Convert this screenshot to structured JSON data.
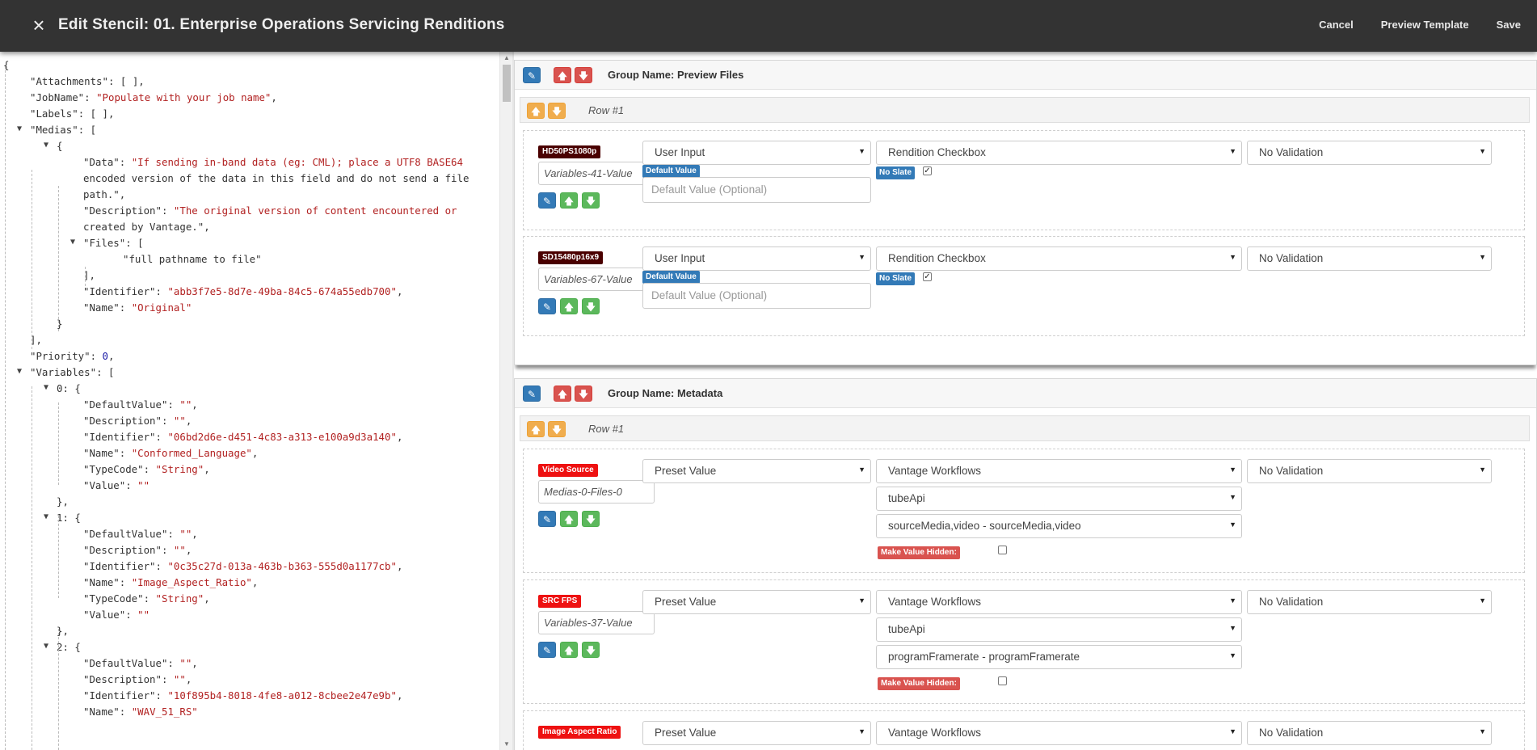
{
  "header": {
    "title": "Edit Stencil: 01. Enterprise Operations Servicing Renditions",
    "close_icon": "×",
    "actions": [
      "Cancel",
      "Preview Template",
      "Save"
    ]
  },
  "json_lines": [
    {
      "text": "{",
      "indent": 0
    },
    {
      "text": "\"Attachments\": [ ],",
      "indent": 1
    },
    {
      "text": "\"JobName\": \"Populate with your job name\",",
      "indent": 1
    },
    {
      "text": "\"Labels\": [ ],",
      "indent": 1
    },
    {
      "text": "\"Medias\": [",
      "indent": 1,
      "toggle": true
    },
    {
      "text": "{",
      "indent": 2,
      "toggle": true
    },
    {
      "text": "\"Data\": \"If sending in-band data (eg: CML); place a UTF8 BASE64",
      "indent": 3
    },
    {
      "text": "encoded version of the data in this field and do not send a file",
      "indent": 3,
      "cont": true
    },
    {
      "text": "path.\",",
      "indent": 3,
      "cont": true
    },
    {
      "text": "\"Description\": \"The original version of content encountered or",
      "indent": 3
    },
    {
      "text": "created by Vantage.\",",
      "indent": 3,
      "cont": true
    },
    {
      "text": "\"Files\": [",
      "indent": 3,
      "toggle": true
    },
    {
      "text": "\"full pathname to file\"",
      "indent": 4,
      "cont": true
    },
    {
      "text": "],",
      "indent": 3
    },
    {
      "text": "\"Identifier\": \"abb3f7e5-8d7e-49ba-84c5-674a55edb700\",",
      "indent": 3
    },
    {
      "text": "\"Name\": \"Original\"",
      "indent": 3
    },
    {
      "text": "}",
      "indent": 2
    },
    {
      "text": "],",
      "indent": 1
    },
    {
      "text": "\"Priority\": 0,",
      "indent": 1
    },
    {
      "text": "\"Variables\": [",
      "indent": 1,
      "toggle": true
    },
    {
      "text": "0: {",
      "indent": 2,
      "toggle": true
    },
    {
      "text": "\"DefaultValue\": \"\",",
      "indent": 3
    },
    {
      "text": "\"Description\": \"\",",
      "indent": 3
    },
    {
      "text": "\"Identifier\": \"06bd2d6e-d451-4c83-a313-e100a9d3a140\",",
      "indent": 3
    },
    {
      "text": "\"Name\": \"Conformed_Language\",",
      "indent": 3
    },
    {
      "text": "\"TypeCode\": \"String\",",
      "indent": 3
    },
    {
      "text": "\"Value\": \"\"",
      "indent": 3
    },
    {
      "text": "},",
      "indent": 2
    },
    {
      "text": "1: {",
      "indent": 2,
      "toggle": true
    },
    {
      "text": "\"DefaultValue\": \"\",",
      "indent": 3
    },
    {
      "text": "\"Description\": \"\",",
      "indent": 3
    },
    {
      "text": "\"Identifier\": \"0c35c27d-013a-463b-b363-555d0a1177cb\",",
      "indent": 3
    },
    {
      "text": "\"Name\": \"Image_Aspect_Ratio\",",
      "indent": 3
    },
    {
      "text": "\"TypeCode\": \"String\",",
      "indent": 3
    },
    {
      "text": "\"Value\": \"\"",
      "indent": 3
    },
    {
      "text": "},",
      "indent": 2
    },
    {
      "text": "2: {",
      "indent": 2,
      "toggle": true
    },
    {
      "text": "\"DefaultValue\": \"\",",
      "indent": 3
    },
    {
      "text": "\"Description\": \"\",",
      "indent": 3
    },
    {
      "text": "\"Identifier\": \"10f895b4-8018-4fe8-a012-8cbee2e47e9b\",",
      "indent": 3
    },
    {
      "text": "\"Name\": \"WAV_51_RS\"",
      "indent": 3
    }
  ],
  "groups": [
    {
      "name": "Group Name: Preview Files",
      "rows": [
        {
          "label": "Row #1",
          "items": [
            {
              "tag": "HD50PS1080p",
              "variable": "Variables-41-Value",
              "source": "User Input",
              "control": "Rendition Checkbox",
              "validation": "No Validation",
              "default_label": "Default Value",
              "default_placeholder": "Default Value (Optional)",
              "slate_label": "No Slate",
              "slate_checked": true
            },
            {
              "tag": "SD15480p16x9",
              "variable": "Variables-67-Value",
              "source": "User Input",
              "control": "Rendition Checkbox",
              "validation": "No Validation",
              "default_label": "Default Value",
              "default_placeholder": "Default Value (Optional)",
              "slate_label": "No Slate",
              "slate_checked": true
            }
          ]
        }
      ]
    },
    {
      "name": "Group Name: Metadata",
      "rows": [
        {
          "label": "Row #1",
          "items": [
            {
              "tag": "Video Source",
              "variable": "Medias-0-Files-0",
              "source": "Preset Value",
              "control": "Vantage Workflows",
              "workflow": "tubeApi",
              "field": "sourceMedia,video - sourceMedia,video",
              "validation": "No Validation",
              "hidden_label": "Make Value Hidden:"
            },
            {
              "tag": "SRC FPS",
              "variable": "Variables-37-Value",
              "source": "Preset Value",
              "control": "Vantage Workflows",
              "workflow": "tubeApi",
              "field": "programFramerate - programFramerate",
              "validation": "No Validation",
              "hidden_label": "Make Value Hidden:"
            },
            {
              "tag": "Image Aspect Ratio",
              "source": "Preset Value",
              "control": "Vantage Workflows",
              "validation": "No Validation"
            }
          ]
        }
      ]
    }
  ],
  "icons": {
    "edit": "pencil-icon",
    "up": "arrow-up-icon",
    "down": "arrow-down-icon",
    "close": "close-icon",
    "caret": "chevron-down-icon"
  },
  "colors": {
    "topbar": "#333333",
    "blue": "#337ab7",
    "red": "#d9534f",
    "orange": "#f0ad4e",
    "green": "#5cb85c",
    "tag_dark": "#4a0000",
    "tag_red": "#ee1111"
  }
}
